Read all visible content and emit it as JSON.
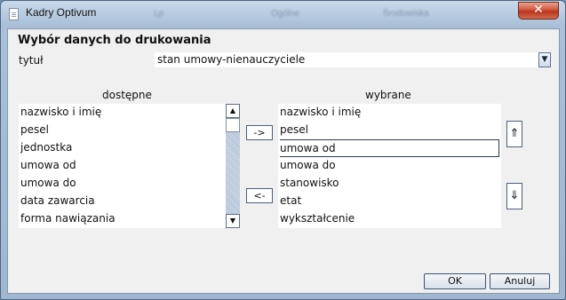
{
  "window": {
    "title": "Kadry Optivum",
    "close_glyph": "✕",
    "background_hints": [
      "Lp",
      "Ogólne",
      "Środowiska"
    ]
  },
  "dialog": {
    "heading": "Wybór danych do drukowania",
    "title_label": "tytuł",
    "title_value": "stan umowy-nienauczyciele",
    "available_label": "dostępne",
    "selected_label": "wybrane",
    "available_items": [
      "nazwisko i imię",
      "pesel",
      "jednostka",
      "umowa od",
      "umowa do",
      "data zawarcia",
      "forma nawiązania"
    ],
    "selected_items": [
      "nazwisko i imię",
      "pesel",
      "umowa od",
      "umowa do",
      "stanowisko",
      "etat",
      "wykształcenie"
    ],
    "selected_index": 2,
    "add_button": "->",
    "remove_button": "<-",
    "move_up_glyph": "⇑",
    "move_down_glyph": "⇓",
    "ok_button": "OK",
    "cancel_button": "Anuluj"
  }
}
